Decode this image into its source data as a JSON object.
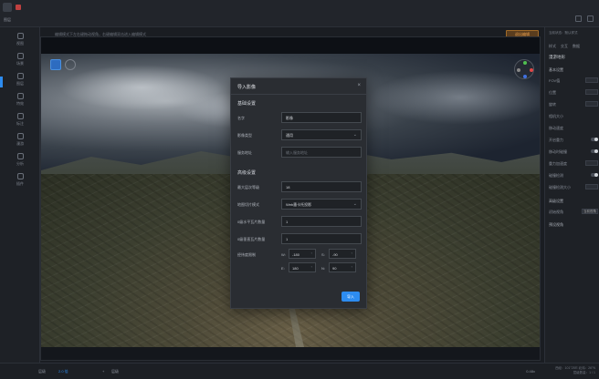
{
  "topbar": {
    "crumb": "图层"
  },
  "leftnav": {
    "items": [
      {
        "label": "视图",
        "icon": "eye-icon"
      },
      {
        "label": "场景",
        "icon": "layers-icon"
      },
      {
        "label": "图层",
        "icon": "location-icon"
      },
      {
        "label": "特效",
        "icon": "sparkle-icon"
      },
      {
        "label": "标注",
        "icon": "pen-icon"
      },
      {
        "label": "漫游",
        "icon": "plane-icon"
      },
      {
        "label": "分析",
        "icon": "chart-icon"
      },
      {
        "label": "插件",
        "icon": "grid-icon"
      }
    ]
  },
  "status": {
    "hint": "编辑模式下左右键拖动视角，右键编辑双击进入编辑模式",
    "exit_edit": "退出编辑"
  },
  "modal": {
    "title": "导入影像",
    "section_basic": "基础设置",
    "name_label": "名字",
    "name_value": "影像",
    "type_label": "影像类型",
    "type_value": "通用",
    "url_label": "服务地址",
    "url_placeholder": "输入服务地址",
    "section_advanced": "高级设置",
    "max_level_label": "最大层次等级",
    "max_level_value": "18",
    "tiling_label": "地图切片模式",
    "tiling_value": "Web墨卡托投影",
    "x_tiles_label": "0级水平瓦片数量",
    "x_tiles_value": "1",
    "y_tiles_label": "0级垂直瓦片数量",
    "y_tiles_value": "1",
    "extent_label": "经纬度限制",
    "w_label": "W:",
    "w_value": "-180",
    "s_label": "S:",
    "s_value": "-90",
    "e_label": "E:",
    "e_value": "180",
    "n_label": "N:",
    "n_value": "90",
    "unit": "°",
    "import_button": "导入"
  },
  "rightpanel": {
    "hint": "当前状态：默认样式",
    "tabs": [
      "样式",
      "交互",
      "数据"
    ],
    "title": "漫游地形",
    "section_basic": "基本设置",
    "rows": [
      {
        "label": "FOV值"
      },
      {
        "label": "位置"
      },
      {
        "label": "旋转"
      },
      {
        "label": "相机大小"
      },
      {
        "label": "移动速度"
      },
      {
        "label": "开启重力"
      },
      {
        "label": "移动时碰撞"
      },
      {
        "label": "重力加速度"
      },
      {
        "label": "碰撞检测"
      },
      {
        "label": "碰撞检测大小"
      }
    ],
    "section_advanced": "高级设置",
    "init_label": "初始视角",
    "init_value": "当前视角",
    "section_preset": "预设视角"
  },
  "bottombar": {
    "item1": "层级",
    "item2": "2.0 倍",
    "item3": "层级",
    "zoom": "0.48x",
    "coords_line1": "西经：101°25'E  北纬：26°N",
    "coords_line2": "层级数量：1 / 1"
  }
}
